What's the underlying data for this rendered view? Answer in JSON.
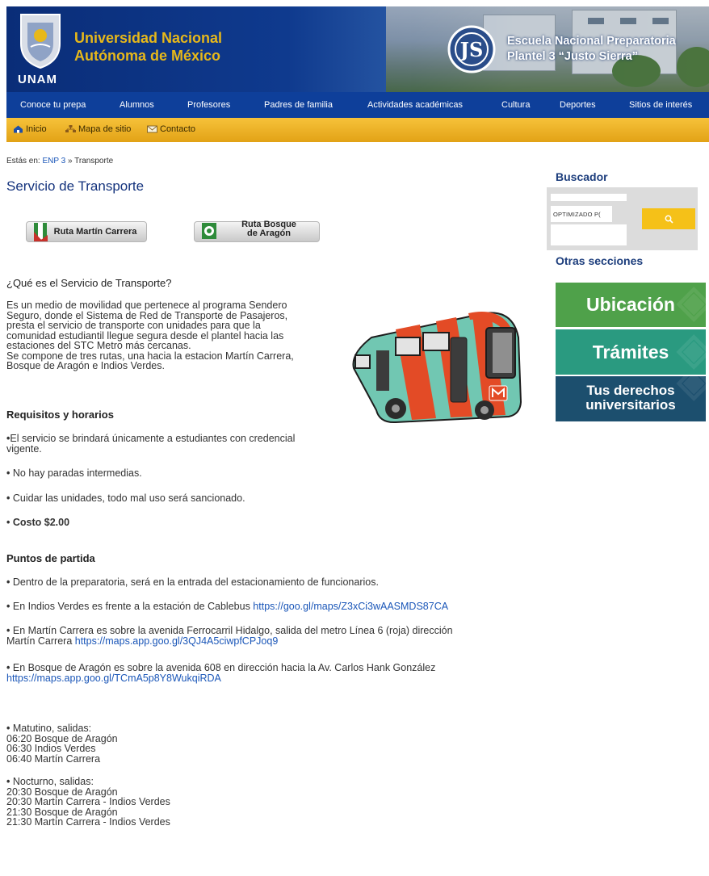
{
  "header": {
    "univ_line1": "Universidad Nacional",
    "univ_line2": "Autónoma de México",
    "unam_label": "UNAM",
    "school_line1": "Escuela Nacional Preparatoria",
    "school_line2": "Plantel 3 “Justo Sierra”"
  },
  "nav": {
    "items": [
      "Conoce tu prepa",
      "Alumnos",
      "Profesores",
      "Padres de familia",
      "Actividades académicas",
      "Cultura",
      "Deportes",
      "Sitios de interés"
    ]
  },
  "subnav": {
    "items": [
      {
        "label": "Inicio",
        "icon": "home-icon"
      },
      {
        "label": "Mapa de sitio",
        "icon": "sitemap-icon"
      },
      {
        "label": "Contacto",
        "icon": "envelope-icon"
      }
    ]
  },
  "breadcrumb": {
    "prefix": "Estás en:",
    "link": "ENP 3",
    "sep": "»",
    "current": "Transporte"
  },
  "page_title": "Servicio de Transporte",
  "route_buttons": {
    "martin": "Ruta Martín Carrera",
    "bosque_line1": "Ruta Bosque",
    "bosque_line2": "de Aragón"
  },
  "section_what": {
    "heading": "¿Qué es el Servicio de Transporte?",
    "lines": [
      "Es un medio de movilidad que pertenece al programa Sendero",
      "Seguro, donde el Sistema de Red de Transporte de Pasajeros,",
      "presta el servicio de transporte con unidades para que la",
      "comunidad estudiantil llegue segura desde el plantel hacia las",
      "estaciones del STC Metro más cercanas.",
      "Se compone de tres rutas, una hacia la estacion Martín Carrera,",
      "Bosque de Aragón e Indios Verdes."
    ]
  },
  "section_req": {
    "heading": "Requisitos y horarios",
    "item1_line1": "El servicio se brindará únicamente a estudiantes con credencial",
    "item1_line2": "vigente.",
    "item2": "No hay paradas intermedias.",
    "item3": "Cuidar las unidades, todo mal uso será sancionado.",
    "item4": "Costo $2.00"
  },
  "section_points": {
    "heading": "Puntos de partida",
    "p1": "Dentro de la preparatoria, será en la entrada del estacionamiento de funcionarios.",
    "p2_text": "En Indios Verdes es frente a la estación de Cablebus ",
    "p2_link": "https://goo.gl/maps/Z3xCi3wAASMDS87CA",
    "p3_line1": "En Martín Carrera es sobre la avenida Ferrocarril Hidalgo, salida del metro Línea 6 (roja) dirección",
    "p3_text2": "Martín Carrera ",
    "p3_link": "https://maps.app.goo.gl/3QJ4A5ciwpfCPJoq9",
    "p4_line1": "En Bosque de Aragón es sobre la avenida 608 en dirección hacia la Av. Carlos Hank González",
    "p4_link": "https://maps.app.goo.gl/TCmA5p8Y8WukqiRDA"
  },
  "schedule": {
    "morning_title": "Matutino, salidas:",
    "morning": [
      "06:20 Bosque de Aragón",
      "06:30 Indios Verdes",
      "06:40 Martín Carrera"
    ],
    "night_title": "Nocturno, salidas:",
    "night": [
      "20:30 Bosque de Aragón",
      "20:30 Martín Carrera - Indios Verdes",
      "21:30 Bosque de Aragón",
      "21:30 Martín Carrera - Indios Verdes"
    ]
  },
  "sidebar": {
    "search_title": "Buscador",
    "search_placeholder": "OPTIMIZADO P(",
    "search_button_icon": "search-icon",
    "other_title": "Otras secciones",
    "tiles": [
      {
        "label": "Ubicación",
        "color": "#4fa14a"
      },
      {
        "label": "Trámites",
        "color": "#2a9a80"
      },
      {
        "label_line1": "Tus derechos",
        "label_line2": "universitarios",
        "color": "#1c4f6e"
      }
    ]
  },
  "colors": {
    "nav_bg": "#0e3f9a",
    "subnav_bg": "#f0b52a",
    "title": "#14337d",
    "link": "#1a56b8"
  }
}
